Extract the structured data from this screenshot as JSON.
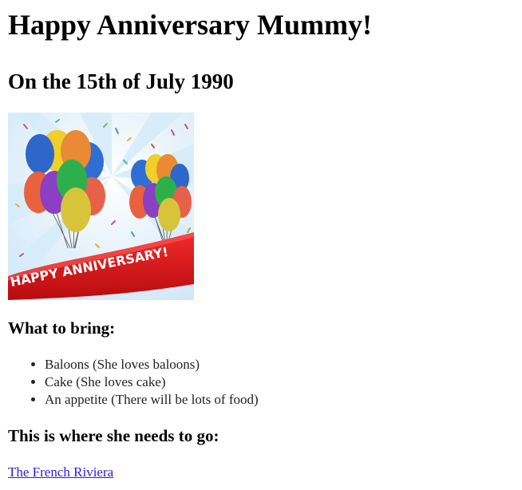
{
  "heading": "Happy Anniversary Mummy!",
  "subheading": "On the 15th of July 1990",
  "banner": {
    "text": "HAPPY ANNIVERSARY!",
    "ribbon_color": "#e0141b"
  },
  "bring": {
    "title": "What to bring:",
    "items": [
      "Baloons (She loves baloons)",
      "Cake (She loves cake)",
      "An appetite (There will be lots of food)"
    ]
  },
  "destination": {
    "title": "This is where she needs to go:",
    "link_text": "The French Riviera"
  },
  "colors": {
    "link": "#2a1ee0"
  }
}
